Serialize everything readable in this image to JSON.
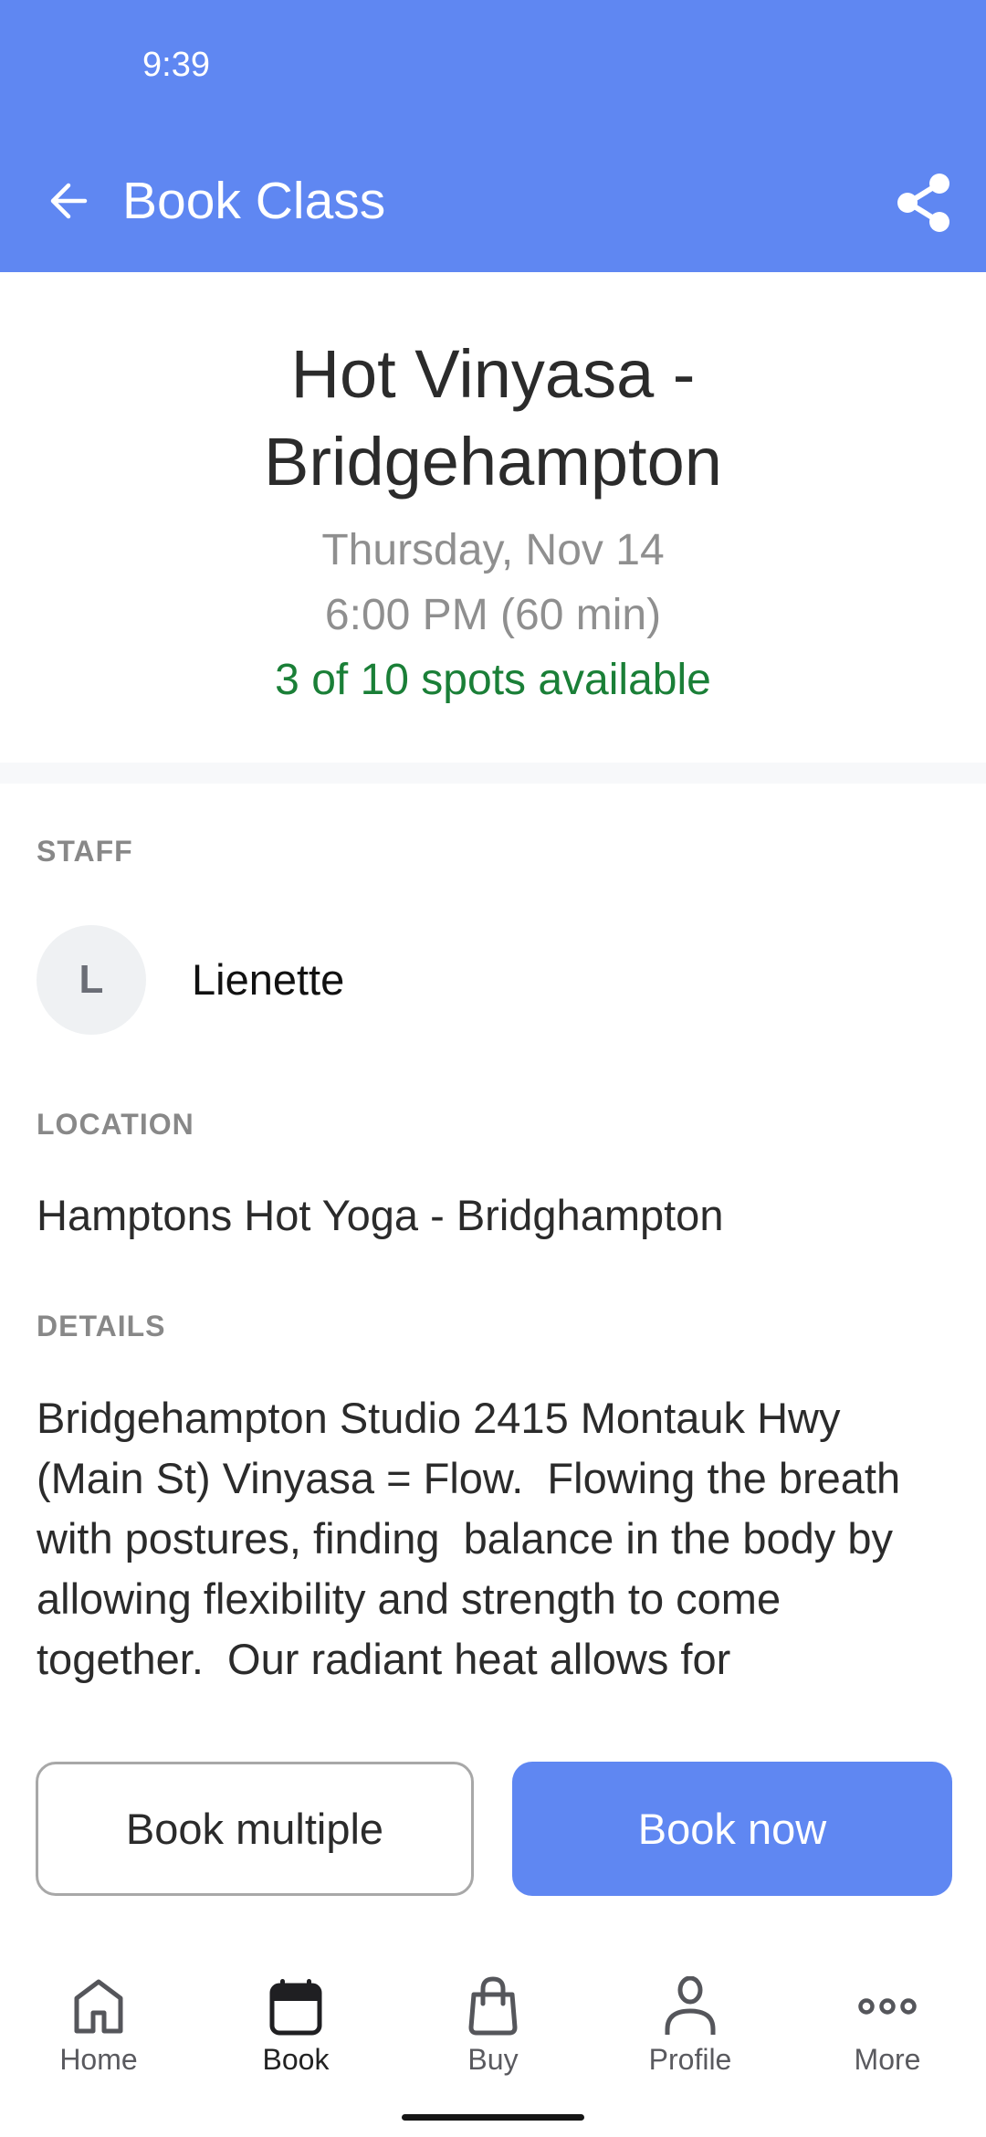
{
  "status_bar": {
    "time": "9:39"
  },
  "app_bar": {
    "title": "Book Class",
    "back_icon": "arrow-left-icon",
    "share_icon": "share-icon",
    "background_color": "#5f87f2"
  },
  "class_info": {
    "title": "Hot Vinyasa - Bridgehampton",
    "date": "Thursday, Nov 14",
    "time": "6:00 PM (60 min)",
    "availability": "3 of 10 spots available",
    "spots_available": 3,
    "spots_total": 10,
    "availability_color": "#1a7f37"
  },
  "staff": {
    "label": "STAFF",
    "avatar_initial": "L",
    "name": "Lienette"
  },
  "location": {
    "label": "LOCATION",
    "value": "Hamptons Hot Yoga - Bridghampton"
  },
  "details": {
    "label": "DETAILS",
    "text": "Bridgehampton Studio 2415 Montauk Hwy (Main St) Vinyasa = Flow.  Flowing the breath with postures, finding  balance in the body by allowing flexibility and strength to come together.  Our radiant heat allows for"
  },
  "actions": {
    "book_multiple": "Book multiple",
    "book_now": "Book now"
  },
  "bottom_nav": {
    "items": [
      {
        "label": "Home",
        "icon": "home-icon",
        "active": false
      },
      {
        "label": "Book",
        "icon": "calendar-icon",
        "active": true
      },
      {
        "label": "Buy",
        "icon": "shopping-bag-icon",
        "active": false
      },
      {
        "label": "Profile",
        "icon": "person-icon",
        "active": false
      },
      {
        "label": "More",
        "icon": "more-dots-icon",
        "active": false
      }
    ]
  }
}
